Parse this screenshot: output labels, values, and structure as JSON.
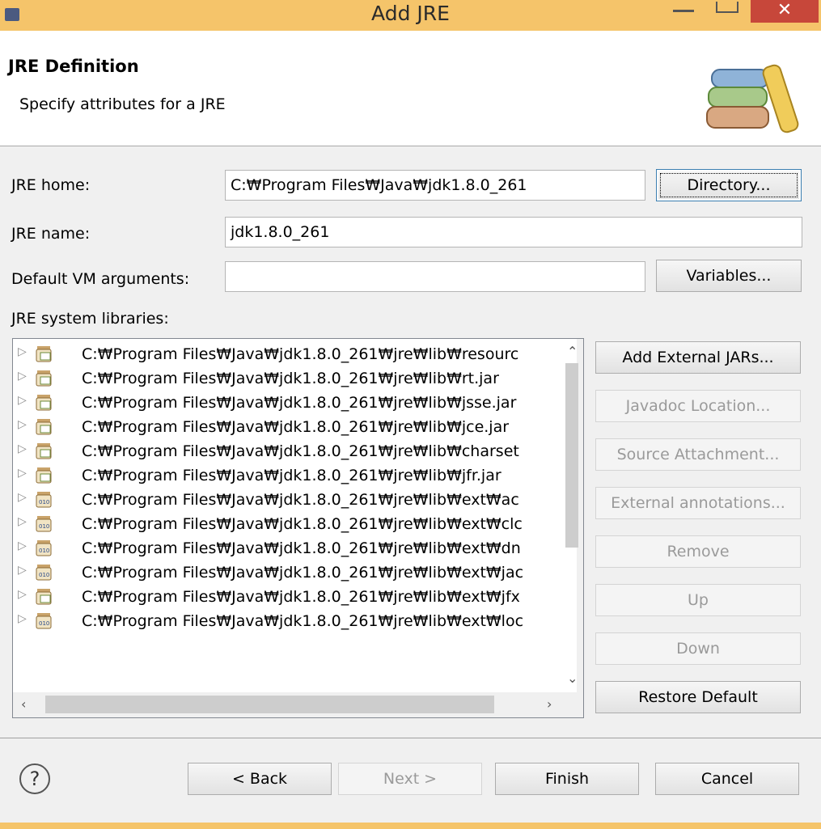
{
  "window": {
    "title": "Add JRE",
    "close_glyph": "✕"
  },
  "header": {
    "title": "JRE Definition",
    "subtitle": "Specify attributes for a JRE",
    "icon": "books-icon"
  },
  "form": {
    "jre_home_label": "JRE home:",
    "jre_home_value": "C:₩Program Files₩Java₩jdk1.8.0_261",
    "directory_button": "Directory...",
    "jre_name_label": "JRE name:",
    "jre_name_value": "jdk1.8.0_261",
    "vm_args_label": "Default VM arguments:",
    "vm_args_value": "",
    "variables_button": "Variables...",
    "libraries_label": "JRE system libraries:"
  },
  "libraries": [
    {
      "text": "C:₩Program Files₩Java₩jdk1.8.0_261₩jre₩lib₩resourc",
      "icon": "source-jar-icon"
    },
    {
      "text": "C:₩Program Files₩Java₩jdk1.8.0_261₩jre₩lib₩rt.jar",
      "icon": "source-jar-icon"
    },
    {
      "text": "C:₩Program Files₩Java₩jdk1.8.0_261₩jre₩lib₩jsse.jar",
      "icon": "source-jar-icon"
    },
    {
      "text": "C:₩Program Files₩Java₩jdk1.8.0_261₩jre₩lib₩jce.jar",
      "icon": "source-jar-icon"
    },
    {
      "text": "C:₩Program Files₩Java₩jdk1.8.0_261₩jre₩lib₩charset",
      "icon": "source-jar-icon"
    },
    {
      "text": "C:₩Program Files₩Java₩jdk1.8.0_261₩jre₩lib₩jfr.jar",
      "icon": "source-jar-icon"
    },
    {
      "text": "C:₩Program Files₩Java₩jdk1.8.0_261₩jre₩lib₩ext₩ac",
      "icon": "binary-jar-icon"
    },
    {
      "text": "C:₩Program Files₩Java₩jdk1.8.0_261₩jre₩lib₩ext₩clc",
      "icon": "binary-jar-icon"
    },
    {
      "text": "C:₩Program Files₩Java₩jdk1.8.0_261₩jre₩lib₩ext₩dn",
      "icon": "binary-jar-icon"
    },
    {
      "text": "C:₩Program Files₩Java₩jdk1.8.0_261₩jre₩lib₩ext₩jac",
      "icon": "binary-jar-icon"
    },
    {
      "text": "C:₩Program Files₩Java₩jdk1.8.0_261₩jre₩lib₩ext₩jfx",
      "icon": "source-jar-icon"
    },
    {
      "text": "C:₩Program Files₩Java₩jdk1.8.0_261₩jre₩lib₩ext₩loc",
      "icon": "binary-jar-icon"
    }
  ],
  "side_buttons": {
    "add_external_jars": "Add External JARs...",
    "javadoc_location": "Javadoc Location...",
    "source_attachment": "Source Attachment...",
    "external_annotations": "External annotations...",
    "remove": "Remove",
    "up": "Up",
    "down": "Down",
    "restore_default": "Restore Default"
  },
  "footer": {
    "help_glyph": "?",
    "back": "< Back",
    "next": "Next >",
    "finish": "Finish",
    "cancel": "Cancel"
  },
  "colors": {
    "titlebar": "#f5c46a",
    "close": "#c7473a",
    "dialog_bg": "#f0f0f0"
  }
}
